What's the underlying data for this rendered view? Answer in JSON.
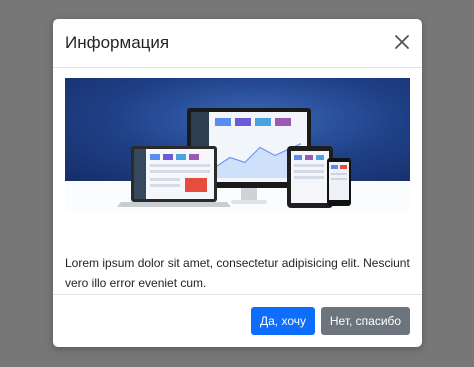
{
  "modal": {
    "title": "Информация",
    "close_icon": "close-icon",
    "body_text": "Lorem ipsum dolor sit amet, consectetur adipisicing elit. Nesciunt vero illo error eveniet cum.",
    "primary_button": "Да, хочу",
    "secondary_button": "Нет, спасибо"
  },
  "colors": {
    "backdrop": "#777777",
    "primary": "#0d6efd",
    "secondary": "#6c757d",
    "hero_blue": "#1f3f86"
  }
}
